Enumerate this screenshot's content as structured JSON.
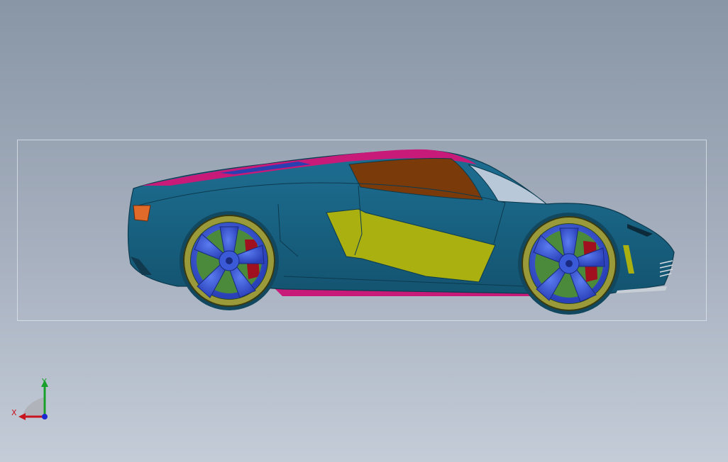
{
  "viewport": {
    "background_top": "#8896a6",
    "background_bottom": "#c4ccd8"
  },
  "model": {
    "colors": {
      "body": "#1a6585",
      "body_shadow": "#124d66",
      "roof_stripe": "#c81a78",
      "roof_blue": "#2a3fb0",
      "side_window": "#7a3a0a",
      "windshield": "#b8c8d8",
      "side_panel": "#aab010",
      "taillight": "#e06a2a",
      "wheel_rim": "#3a5ad8",
      "tire": "#9a9a3a",
      "brake_caliper": "#a0101e",
      "brake_disc": "#4a8a3a"
    }
  },
  "triad": {
    "x_label": "X",
    "y_label": "Y",
    "x_color": "#c8141e",
    "y_color": "#18a02a",
    "z_color": "#1a2ad0"
  }
}
